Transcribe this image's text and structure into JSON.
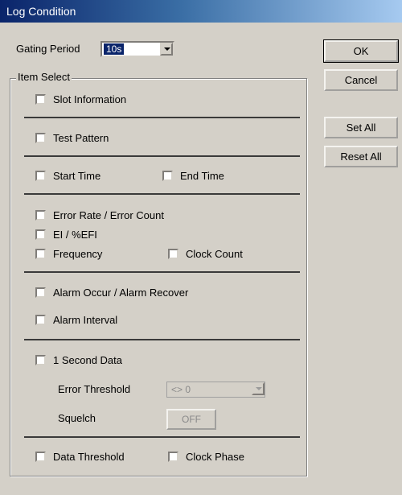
{
  "window": {
    "title": "Log Condition"
  },
  "gating": {
    "label": "Gating Period",
    "value": "10s"
  },
  "buttons": {
    "ok": "OK",
    "cancel": "Cancel",
    "set_all": "Set All",
    "reset_all": "Reset All"
  },
  "group": {
    "title": "Item Select"
  },
  "items": {
    "slot_information": {
      "label": "Slot Information",
      "checked": false
    },
    "test_pattern": {
      "label": "Test Pattern",
      "checked": false
    },
    "start_time": {
      "label": "Start Time",
      "checked": false
    },
    "end_time": {
      "label": "End Time",
      "checked": false
    },
    "error_rate": {
      "label": "Error Rate / Error Count",
      "checked": false
    },
    "ei_efi": {
      "label": "EI / %EFI",
      "checked": false
    },
    "frequency": {
      "label": "Frequency",
      "checked": false
    },
    "clock_count": {
      "label": "Clock Count",
      "checked": false
    },
    "alarm_occur": {
      "label": "Alarm Occur / Alarm Recover",
      "checked": false
    },
    "alarm_interval": {
      "label": "Alarm Interval",
      "checked": false
    },
    "one_second_data": {
      "label": "1 Second Data",
      "checked": false
    },
    "data_threshold": {
      "label": "Data Threshold",
      "checked": false
    },
    "clock_phase": {
      "label": "Clock Phase",
      "checked": false
    }
  },
  "error_threshold": {
    "label": "Error Threshold",
    "value": "<> 0"
  },
  "squelch": {
    "label": "Squelch",
    "value": "OFF"
  }
}
